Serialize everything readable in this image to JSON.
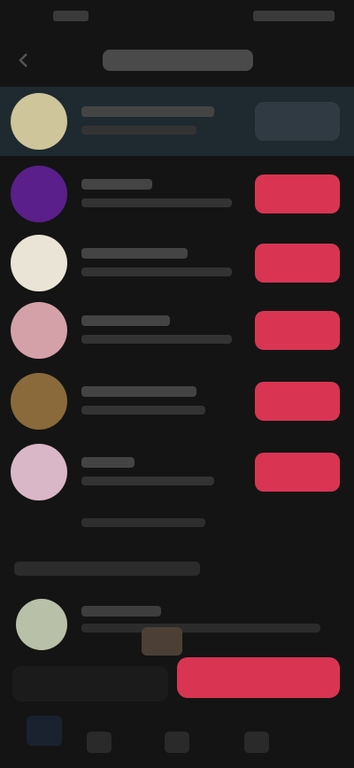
{
  "colors": {
    "background": "#141414",
    "follow_button": "#d93553",
    "following_button": "#2f3a42",
    "highlight_row": "#1f2a30"
  },
  "header": {
    "back_icon": "arrow-left-icon"
  },
  "accounts": [
    {
      "avatar_color": "#cfc59a",
      "state": "following"
    },
    {
      "avatar_color": "#5a1f8a",
      "state": "follow"
    },
    {
      "avatar_color": "#e9e4d5",
      "state": "follow"
    },
    {
      "avatar_color": "#d4a1a8",
      "state": "follow"
    },
    {
      "avatar_color": "#8a6a3a",
      "state": "follow"
    },
    {
      "avatar_color": "#d9b7c6",
      "state": "follow"
    }
  ],
  "suggested": {
    "avatar_color": "#b8c0a8"
  },
  "bottom_nav": {
    "icons": [
      "home-icon",
      "search-icon",
      "profile-icon"
    ]
  }
}
